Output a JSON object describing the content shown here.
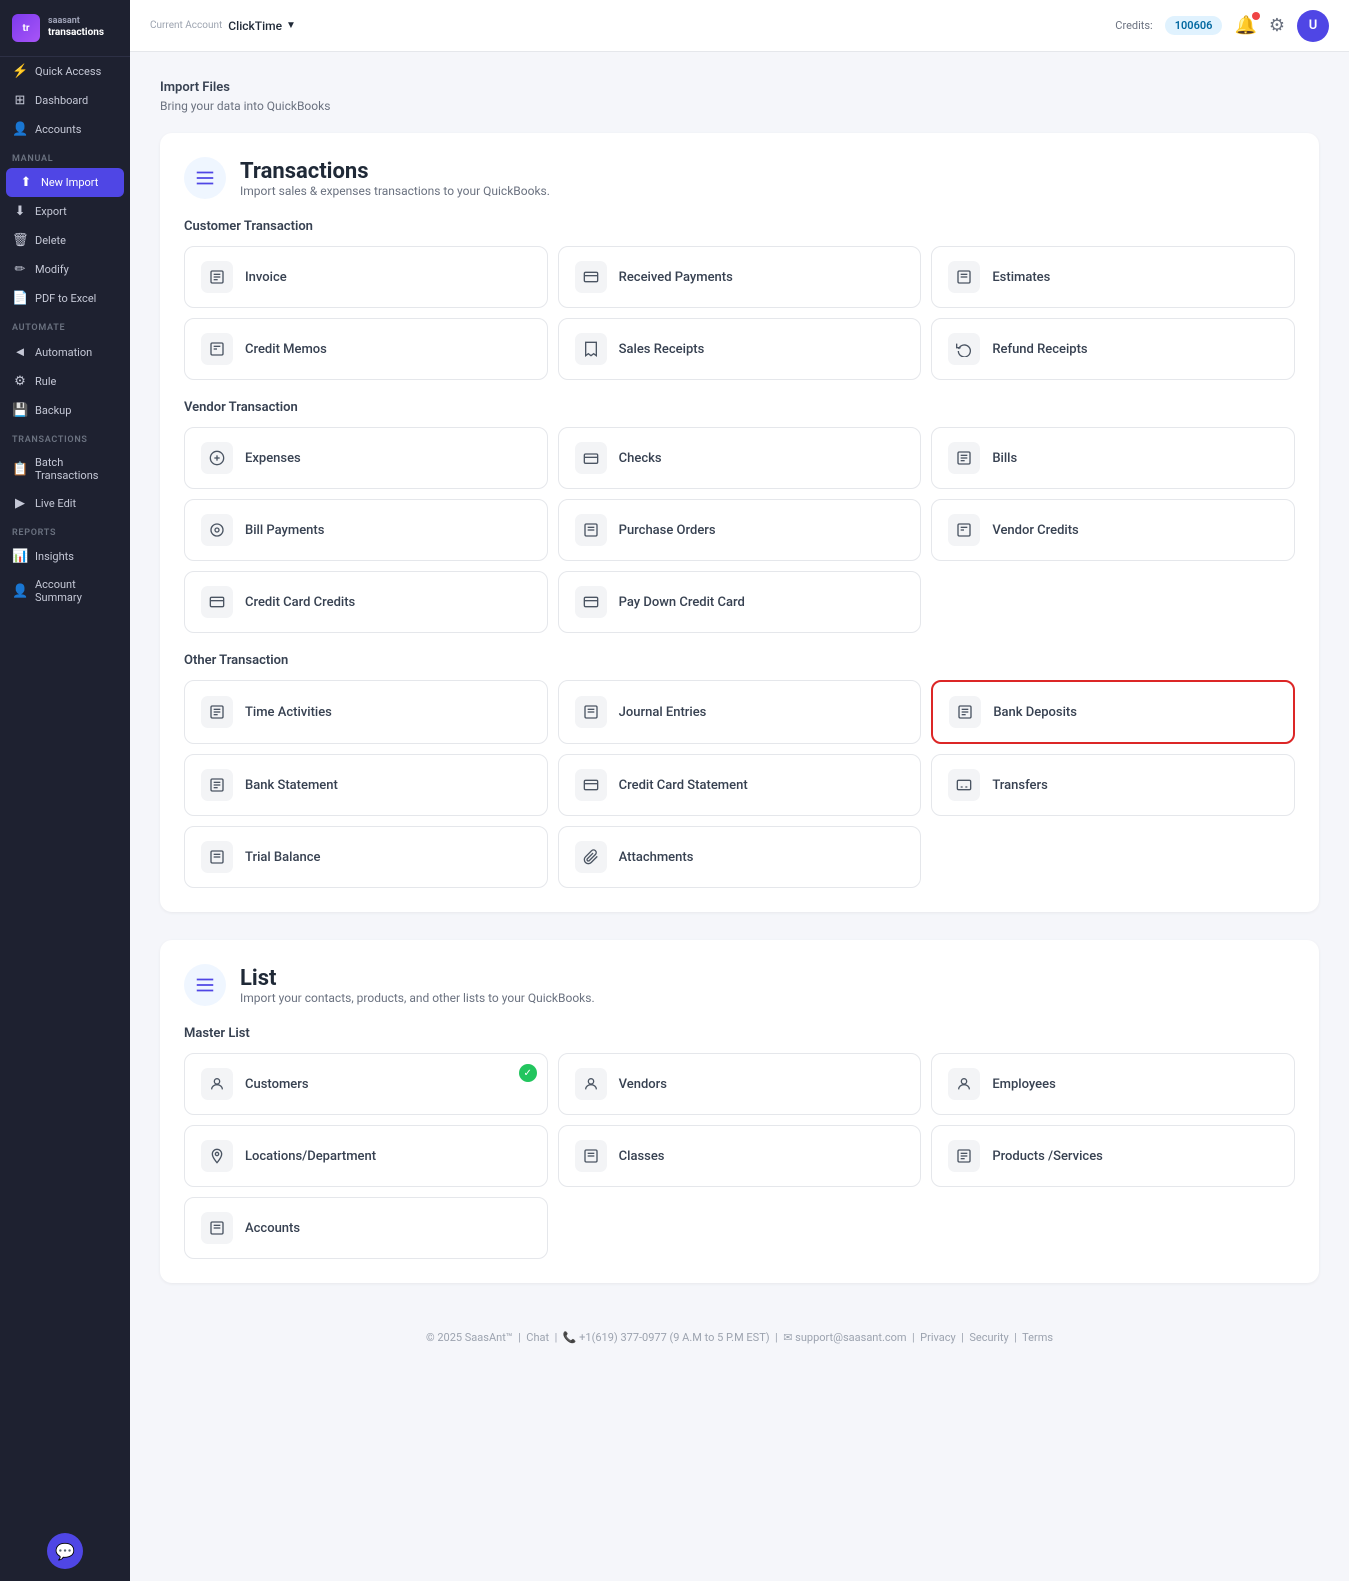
{
  "app": {
    "logo_abbr": "tr",
    "brand_name": "transactions",
    "brand_full": "saasant\ntransactions"
  },
  "header": {
    "current_account_label": "Current Account",
    "account_name": "ClickTime",
    "credits_label": "Credits:",
    "credits_value": "100606",
    "notification_count": "1"
  },
  "sidebar": {
    "sections": [
      {
        "label": "",
        "items": [
          {
            "id": "quick-access",
            "label": "Quick Access",
            "icon": "⚡"
          },
          {
            "id": "dashboard",
            "label": "Dashboard",
            "icon": "⊞"
          },
          {
            "id": "accounts",
            "label": "Accounts",
            "icon": "👤"
          }
        ]
      },
      {
        "label": "MANUAL",
        "items": [
          {
            "id": "new-import",
            "label": "New Import",
            "icon": "⬆",
            "active": true
          },
          {
            "id": "export",
            "label": "Export",
            "icon": "⬇"
          },
          {
            "id": "delete",
            "label": "Delete",
            "icon": "🗑"
          },
          {
            "id": "modify",
            "label": "Modify",
            "icon": "✏"
          },
          {
            "id": "pdf-to-excel",
            "label": "PDF to Excel",
            "icon": "📄"
          }
        ]
      },
      {
        "label": "AUTOMATE",
        "items": [
          {
            "id": "automation",
            "label": "Automation",
            "icon": "◄"
          },
          {
            "id": "rule",
            "label": "Rule",
            "icon": "⚙"
          },
          {
            "id": "backup",
            "label": "Backup",
            "icon": "💾"
          }
        ]
      },
      {
        "label": "TRANSACTIONS",
        "items": [
          {
            "id": "batch-transactions",
            "label": "Batch Transactions",
            "icon": "📋"
          },
          {
            "id": "live-edit",
            "label": "Live Edit",
            "icon": "▶"
          }
        ]
      },
      {
        "label": "REPORTS",
        "items": [
          {
            "id": "insights",
            "label": "Insights",
            "icon": "📊"
          },
          {
            "id": "account-summary",
            "label": "Account Summary",
            "icon": "👤"
          }
        ]
      }
    ]
  },
  "page": {
    "import_files_title": "Import Files",
    "import_files_desc": "Bring your data into QuickBooks",
    "transactions_title": "Transactions",
    "transactions_desc": "Import sales & expenses transactions to your QuickBooks.",
    "list_title": "List",
    "list_desc": "Import your contacts, products, and other lists to your QuickBooks.",
    "transactions_icon": "≡",
    "list_icon": "≡"
  },
  "customer_transaction": {
    "label": "Customer Transaction",
    "cards": [
      {
        "id": "invoice",
        "label": "Invoice",
        "icon": "📋"
      },
      {
        "id": "received-payments",
        "label": "Received Payments",
        "icon": "💳"
      },
      {
        "id": "estimates",
        "label": "Estimates",
        "icon": "📋"
      },
      {
        "id": "credit-memos",
        "label": "Credit Memos",
        "icon": "📋"
      },
      {
        "id": "sales-receipts",
        "label": "Sales Receipts",
        "icon": "🧾"
      },
      {
        "id": "refund-receipts",
        "label": "Refund Receipts",
        "icon": "🔄"
      }
    ]
  },
  "vendor_transaction": {
    "label": "Vendor Transaction",
    "cards": [
      {
        "id": "expenses",
        "label": "Expenses",
        "icon": "🧾"
      },
      {
        "id": "checks",
        "label": "Checks",
        "icon": "⬜"
      },
      {
        "id": "bills",
        "label": "Bills",
        "icon": "📋"
      },
      {
        "id": "bill-payments",
        "label": "Bill Payments",
        "icon": "⊙"
      },
      {
        "id": "purchase-orders",
        "label": "Purchase Orders",
        "icon": "📋"
      },
      {
        "id": "vendor-credits",
        "label": "Vendor Credits",
        "icon": "📋"
      },
      {
        "id": "credit-card-credits",
        "label": "Credit Card Credits",
        "icon": "💳"
      },
      {
        "id": "pay-down-credit-card",
        "label": "Pay Down Credit Card",
        "icon": "💳"
      }
    ]
  },
  "other_transaction": {
    "label": "Other Transaction",
    "cards": [
      {
        "id": "time-activities",
        "label": "Time Activities",
        "icon": "📋"
      },
      {
        "id": "journal-entries",
        "label": "Journal Entries",
        "icon": "📋"
      },
      {
        "id": "bank-deposits",
        "label": "Bank Deposits",
        "icon": "🏦",
        "highlighted": true
      },
      {
        "id": "bank-statement",
        "label": "Bank Statement",
        "icon": "📋"
      },
      {
        "id": "credit-card-statement",
        "label": "Credit Card Statement",
        "icon": "💳"
      },
      {
        "id": "transfers",
        "label": "Transfers",
        "icon": "💳"
      },
      {
        "id": "trial-balance",
        "label": "Trial Balance",
        "icon": "📋"
      },
      {
        "id": "attachments",
        "label": "Attachments",
        "icon": "📎"
      }
    ]
  },
  "master_list": {
    "label": "Master List",
    "cards": [
      {
        "id": "customers",
        "label": "Customers",
        "icon": "👤",
        "checked": true
      },
      {
        "id": "vendors",
        "label": "Vendors",
        "icon": "👤"
      },
      {
        "id": "employees",
        "label": "Employees",
        "icon": "👤"
      },
      {
        "id": "locations-department",
        "label": "Locations/Department",
        "icon": "📍"
      },
      {
        "id": "classes",
        "label": "Classes",
        "icon": "📋"
      },
      {
        "id": "products-services",
        "label": "Products /Services",
        "icon": "📋"
      },
      {
        "id": "accounts",
        "label": "Accounts",
        "icon": "📋"
      }
    ]
  },
  "footer": {
    "copy": "© 2025 SaasAnt™",
    "chat": "Chat",
    "phone": "+1(619) 377-0977 (9 A.M to 5 P.M EST)",
    "email": "support@saasant.com",
    "links": [
      "Privacy",
      "Security",
      "Terms"
    ]
  }
}
